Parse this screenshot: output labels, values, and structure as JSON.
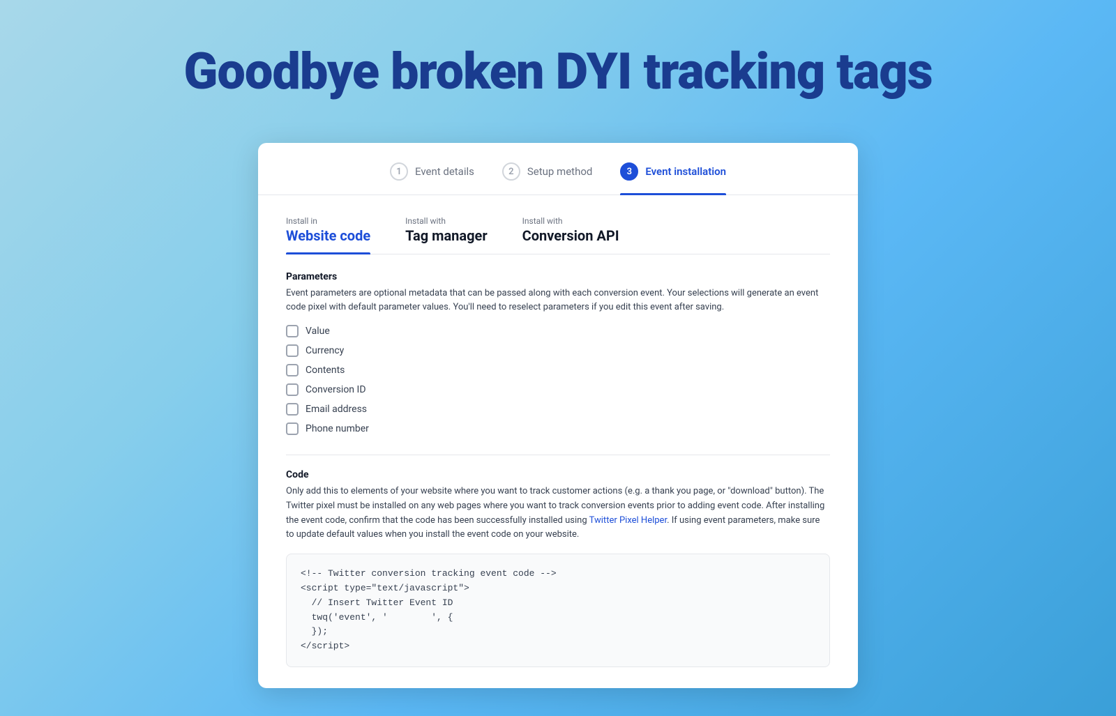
{
  "headline": "Goodbye broken DYI tracking tags",
  "steps": [
    {
      "number": "1",
      "label": "Event details",
      "active": false
    },
    {
      "number": "2",
      "label": "Setup method",
      "active": false
    },
    {
      "number": "3",
      "label": "Event installation",
      "active": true
    }
  ],
  "install_tabs": [
    {
      "id": "website",
      "label": "Install in",
      "title": "Website code",
      "active": true
    },
    {
      "id": "tagmanager",
      "label": "Install with",
      "title": "Tag manager",
      "active": false
    },
    {
      "id": "api",
      "label": "Install with",
      "title": "Conversion API",
      "active": false
    }
  ],
  "parameters": {
    "title": "Parameters",
    "description": "Event parameters are optional metadata that can be passed along with each conversion event. Your selections will generate an event code pixel with default parameter values. You'll need to reselect parameters if you edit this event after saving.",
    "checkboxes": [
      {
        "id": "value",
        "label": "Value"
      },
      {
        "id": "currency",
        "label": "Currency"
      },
      {
        "id": "contents",
        "label": "Contents"
      },
      {
        "id": "conversion_id",
        "label": "Conversion ID"
      },
      {
        "id": "email",
        "label": "Email address"
      },
      {
        "id": "phone",
        "label": "Phone number"
      }
    ]
  },
  "code": {
    "title": "Code",
    "description1": "Only add this to elements of your website where you want to track customer actions (e.g. a thank you page, or \"download\" button). The Twitter pixel must be installed on any web pages where you want to track conversion events prior to adding event code. After installing the event code, confirm that the code has been successfully installed using ",
    "link_text": "Twitter Pixel Helper",
    "description2": ". If using event parameters, make sure to update default values when you install the event code on your website.",
    "snippet": [
      "<!-- Twitter conversion tracking event code -->",
      "<script type=\"text/javascript\">",
      "  // Insert Twitter Event ID",
      "  twq('event', '        ', {",
      "  });",
      "</script>"
    ]
  }
}
